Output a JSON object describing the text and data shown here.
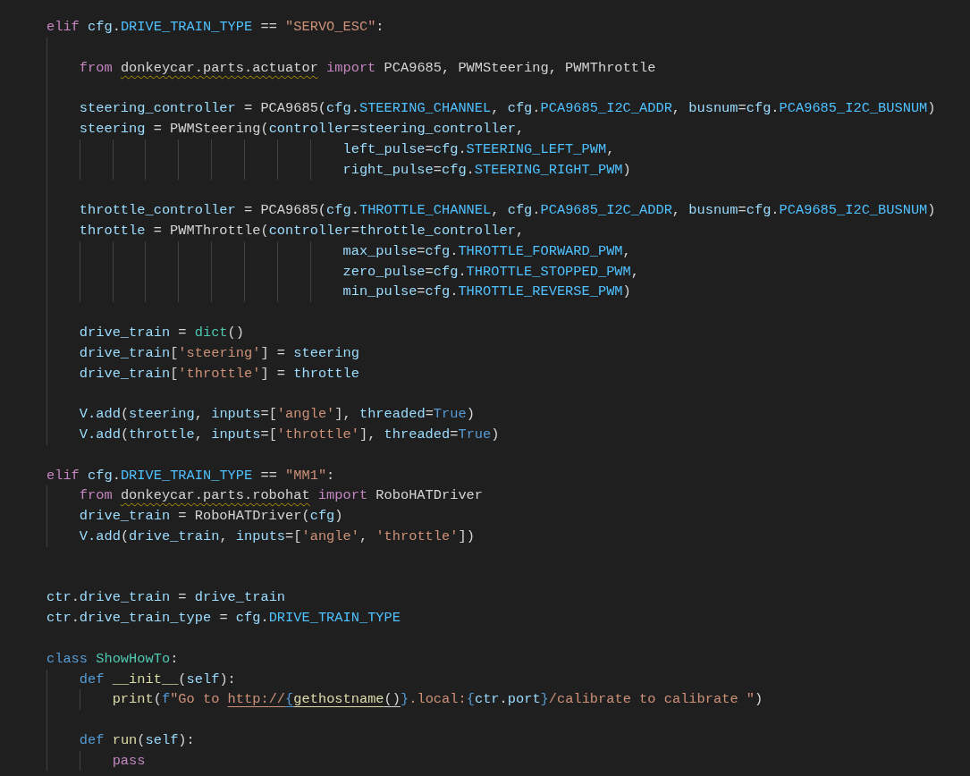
{
  "editor": {
    "lines": [
      {
        "kind": "code",
        "tokens": [
          {
            "t": "elif ",
            "kind": "keyword"
          },
          {
            "t": "cfg",
            "kind": "variable"
          },
          {
            "t": ".",
            "kind": "plain"
          },
          {
            "t": "DRIVE_TRAIN_TYPE",
            "kind": "constant"
          },
          {
            "t": " == ",
            "kind": "plain"
          },
          {
            "t": "\"SERVO_ESC\"",
            "kind": "string"
          },
          {
            "t": ":",
            "kind": "plain"
          }
        ]
      },
      {
        "kind": "blank"
      },
      {
        "kind": "code",
        "tokens": [
          {
            "t": "    from ",
            "kind": "keyword"
          },
          {
            "t": "donkeycar.parts.actuator",
            "kind": "unresolved"
          },
          {
            "t": " import ",
            "kind": "keyword"
          },
          {
            "t": "PCA9685, PWMSteering, PWMThrottle",
            "kind": "plain"
          }
        ]
      },
      {
        "kind": "blank"
      },
      {
        "kind": "code",
        "tokens": [
          {
            "t": "    steering_controller",
            "kind": "variable"
          },
          {
            "t": " = PCA9685(",
            "kind": "plain"
          },
          {
            "t": "cfg",
            "kind": "variable"
          },
          {
            "t": ".",
            "kind": "plain"
          },
          {
            "t": "STEERING_CHANNEL",
            "kind": "constant"
          },
          {
            "t": ", ",
            "kind": "plain"
          },
          {
            "t": "cfg",
            "kind": "variable"
          },
          {
            "t": ".",
            "kind": "plain"
          },
          {
            "t": "PCA9685_I2C_ADDR",
            "kind": "constant"
          },
          {
            "t": ", ",
            "kind": "plain"
          },
          {
            "t": "busnum",
            "kind": "variable"
          },
          {
            "t": "=",
            "kind": "plain"
          },
          {
            "t": "cfg",
            "kind": "variable"
          },
          {
            "t": ".",
            "kind": "plain"
          },
          {
            "t": "PCA9685_I2C_BUSNUM",
            "kind": "constant"
          },
          {
            "t": ")",
            "kind": "plain"
          }
        ]
      },
      {
        "kind": "code",
        "tokens": [
          {
            "t": "    steering",
            "kind": "variable"
          },
          {
            "t": " = PWMSteering(",
            "kind": "plain"
          },
          {
            "t": "controller",
            "kind": "variable"
          },
          {
            "t": "=",
            "kind": "plain"
          },
          {
            "t": "steering_controller",
            "kind": "variable"
          },
          {
            "t": ",",
            "kind": "plain"
          }
        ]
      },
      {
        "kind": "code",
        "tokens": [
          {
            "t": "                                    left_pulse",
            "kind": "variable"
          },
          {
            "t": "=",
            "kind": "plain"
          },
          {
            "t": "cfg",
            "kind": "variable"
          },
          {
            "t": ".",
            "kind": "plain"
          },
          {
            "t": "STEERING_LEFT_PWM",
            "kind": "constant"
          },
          {
            "t": ",",
            "kind": "plain"
          }
        ]
      },
      {
        "kind": "code",
        "tokens": [
          {
            "t": "                                    right_pulse",
            "kind": "variable"
          },
          {
            "t": "=",
            "kind": "plain"
          },
          {
            "t": "cfg",
            "kind": "variable"
          },
          {
            "t": ".",
            "kind": "plain"
          },
          {
            "t": "STEERING_RIGHT_PWM",
            "kind": "constant"
          },
          {
            "t": ")",
            "kind": "plain"
          }
        ]
      },
      {
        "kind": "blank"
      },
      {
        "kind": "code",
        "tokens": [
          {
            "t": "    throttle_controller",
            "kind": "variable"
          },
          {
            "t": " = PCA9685(",
            "kind": "plain"
          },
          {
            "t": "cfg",
            "kind": "variable"
          },
          {
            "t": ".",
            "kind": "plain"
          },
          {
            "t": "THROTTLE_CHANNEL",
            "kind": "constant"
          },
          {
            "t": ", ",
            "kind": "plain"
          },
          {
            "t": "cfg",
            "kind": "variable"
          },
          {
            "t": ".",
            "kind": "plain"
          },
          {
            "t": "PCA9685_I2C_ADDR",
            "kind": "constant"
          },
          {
            "t": ", ",
            "kind": "plain"
          },
          {
            "t": "busnum",
            "kind": "variable"
          },
          {
            "t": "=",
            "kind": "plain"
          },
          {
            "t": "cfg",
            "kind": "variable"
          },
          {
            "t": ".",
            "kind": "plain"
          },
          {
            "t": "PCA9685_I2C_BUSNUM",
            "kind": "constant"
          },
          {
            "t": ")",
            "kind": "plain"
          }
        ]
      },
      {
        "kind": "code",
        "tokens": [
          {
            "t": "    throttle",
            "kind": "variable"
          },
          {
            "t": " = PWMThrottle(",
            "kind": "plain"
          },
          {
            "t": "controller",
            "kind": "variable"
          },
          {
            "t": "=",
            "kind": "plain"
          },
          {
            "t": "throttle_controller",
            "kind": "variable"
          },
          {
            "t": ",",
            "kind": "plain"
          }
        ]
      },
      {
        "kind": "code",
        "tokens": [
          {
            "t": "                                    max_pulse",
            "kind": "variable"
          },
          {
            "t": "=",
            "kind": "plain"
          },
          {
            "t": "cfg",
            "kind": "variable"
          },
          {
            "t": ".",
            "kind": "plain"
          },
          {
            "t": "THROTTLE_FORWARD_PWM",
            "kind": "constant"
          },
          {
            "t": ",",
            "kind": "plain"
          }
        ]
      },
      {
        "kind": "code",
        "tokens": [
          {
            "t": "                                    zero_pulse",
            "kind": "variable"
          },
          {
            "t": "=",
            "kind": "plain"
          },
          {
            "t": "cfg",
            "kind": "variable"
          },
          {
            "t": ".",
            "kind": "plain"
          },
          {
            "t": "THROTTLE_STOPPED_PWM",
            "kind": "constant"
          },
          {
            "t": ",",
            "kind": "plain"
          }
        ]
      },
      {
        "kind": "code",
        "tokens": [
          {
            "t": "                                    min_pulse",
            "kind": "variable"
          },
          {
            "t": "=",
            "kind": "plain"
          },
          {
            "t": "cfg",
            "kind": "variable"
          },
          {
            "t": ".",
            "kind": "plain"
          },
          {
            "t": "THROTTLE_REVERSE_PWM",
            "kind": "constant"
          },
          {
            "t": ")",
            "kind": "plain"
          }
        ]
      },
      {
        "kind": "blank"
      },
      {
        "kind": "code",
        "tokens": [
          {
            "t": "    drive_train",
            "kind": "variable"
          },
          {
            "t": " = ",
            "kind": "plain"
          },
          {
            "t": "dict",
            "kind": "class"
          },
          {
            "t": "()",
            "kind": "plain"
          }
        ]
      },
      {
        "kind": "code",
        "tokens": [
          {
            "t": "    drive_train",
            "kind": "variable"
          },
          {
            "t": "[",
            "kind": "plain"
          },
          {
            "t": "'steering'",
            "kind": "string"
          },
          {
            "t": "] = ",
            "kind": "plain"
          },
          {
            "t": "steering",
            "kind": "variable"
          }
        ]
      },
      {
        "kind": "code",
        "tokens": [
          {
            "t": "    drive_train",
            "kind": "variable"
          },
          {
            "t": "[",
            "kind": "plain"
          },
          {
            "t": "'throttle'",
            "kind": "string"
          },
          {
            "t": "] = ",
            "kind": "plain"
          },
          {
            "t": "throttle",
            "kind": "variable"
          }
        ]
      },
      {
        "kind": "blank"
      },
      {
        "kind": "code",
        "tokens": [
          {
            "t": "    V.add",
            "kind": "variable"
          },
          {
            "t": "(",
            "kind": "plain"
          },
          {
            "t": "steering",
            "kind": "variable"
          },
          {
            "t": ", ",
            "kind": "plain"
          },
          {
            "t": "inputs",
            "kind": "variable"
          },
          {
            "t": "=[",
            "kind": "plain"
          },
          {
            "t": "'angle'",
            "kind": "string"
          },
          {
            "t": "], ",
            "kind": "plain"
          },
          {
            "t": "threaded",
            "kind": "variable"
          },
          {
            "t": "=",
            "kind": "plain"
          },
          {
            "t": "True",
            "kind": "storage"
          },
          {
            "t": ")",
            "kind": "plain"
          }
        ]
      },
      {
        "kind": "code",
        "tokens": [
          {
            "t": "    V.add",
            "kind": "variable"
          },
          {
            "t": "(",
            "kind": "plain"
          },
          {
            "t": "throttle",
            "kind": "variable"
          },
          {
            "t": ", ",
            "kind": "plain"
          },
          {
            "t": "inputs",
            "kind": "variable"
          },
          {
            "t": "=[",
            "kind": "plain"
          },
          {
            "t": "'throttle'",
            "kind": "string"
          },
          {
            "t": "], ",
            "kind": "plain"
          },
          {
            "t": "threaded",
            "kind": "variable"
          },
          {
            "t": "=",
            "kind": "plain"
          },
          {
            "t": "True",
            "kind": "storage"
          },
          {
            "t": ")",
            "kind": "plain"
          }
        ]
      },
      {
        "kind": "blank"
      },
      {
        "kind": "code",
        "tokens": [
          {
            "t": "elif ",
            "kind": "keyword"
          },
          {
            "t": "cfg",
            "kind": "variable"
          },
          {
            "t": ".",
            "kind": "plain"
          },
          {
            "t": "DRIVE_TRAIN_TYPE",
            "kind": "constant"
          },
          {
            "t": " == ",
            "kind": "plain"
          },
          {
            "t": "\"MM1\"",
            "kind": "string"
          },
          {
            "t": ":",
            "kind": "plain"
          }
        ]
      },
      {
        "kind": "code",
        "tokens": [
          {
            "t": "    from ",
            "kind": "keyword"
          },
          {
            "t": "donkeycar.parts.robohat",
            "kind": "unresolved"
          },
          {
            "t": " import ",
            "kind": "keyword"
          },
          {
            "t": "RoboHATDriver",
            "kind": "plain"
          }
        ]
      },
      {
        "kind": "code",
        "tokens": [
          {
            "t": "    drive_train",
            "kind": "variable"
          },
          {
            "t": " = RoboHATDriver(",
            "kind": "plain"
          },
          {
            "t": "cfg",
            "kind": "variable"
          },
          {
            "t": ")",
            "kind": "plain"
          }
        ]
      },
      {
        "kind": "code",
        "tokens": [
          {
            "t": "    V.add",
            "kind": "variable"
          },
          {
            "t": "(",
            "kind": "plain"
          },
          {
            "t": "drive_train",
            "kind": "variable"
          },
          {
            "t": ", ",
            "kind": "plain"
          },
          {
            "t": "inputs",
            "kind": "variable"
          },
          {
            "t": "=[",
            "kind": "plain"
          },
          {
            "t": "'angle'",
            "kind": "string"
          },
          {
            "t": ", ",
            "kind": "plain"
          },
          {
            "t": "'throttle'",
            "kind": "string"
          },
          {
            "t": "])",
            "kind": "plain"
          }
        ]
      },
      {
        "kind": "blank"
      },
      {
        "kind": "blank"
      },
      {
        "kind": "code",
        "tokens": [
          {
            "t": "ctr",
            "kind": "variable"
          },
          {
            "t": ".",
            "kind": "plain"
          },
          {
            "t": "drive_train",
            "kind": "variable"
          },
          {
            "t": " = ",
            "kind": "plain"
          },
          {
            "t": "drive_train",
            "kind": "variable"
          }
        ]
      },
      {
        "kind": "code",
        "tokens": [
          {
            "t": "ctr",
            "kind": "variable"
          },
          {
            "t": ".",
            "kind": "plain"
          },
          {
            "t": "drive_train_type",
            "kind": "variable"
          },
          {
            "t": " = ",
            "kind": "plain"
          },
          {
            "t": "cfg",
            "kind": "variable"
          },
          {
            "t": ".",
            "kind": "plain"
          },
          {
            "t": "DRIVE_TRAIN_TYPE",
            "kind": "constant"
          }
        ]
      },
      {
        "kind": "blank"
      },
      {
        "kind": "code",
        "tokens": [
          {
            "t": "class ",
            "kind": "storage"
          },
          {
            "t": "ShowHowTo",
            "kind": "class"
          },
          {
            "t": ":",
            "kind": "plain"
          }
        ]
      },
      {
        "kind": "code",
        "tokens": [
          {
            "t": "    def ",
            "kind": "storage"
          },
          {
            "t": "__init__",
            "kind": "function"
          },
          {
            "t": "(",
            "kind": "plain"
          },
          {
            "t": "self",
            "kind": "variable"
          },
          {
            "t": "):",
            "kind": "plain"
          }
        ]
      },
      {
        "kind": "code",
        "tokens": [
          {
            "t": "        print",
            "kind": "function"
          },
          {
            "t": "(",
            "kind": "plain"
          },
          {
            "t": "f",
            "kind": "storage"
          },
          {
            "t": "\"Go to ",
            "kind": "string"
          },
          {
            "t": "http://",
            "kind": "link_string"
          },
          {
            "t": "{",
            "kind": "link_storage"
          },
          {
            "t": "gethostname",
            "kind": "link_function"
          },
          {
            "t": "()",
            "kind": "link_plain"
          },
          {
            "t": "}",
            "kind": "storage"
          },
          {
            "t": ".local:",
            "kind": "string"
          },
          {
            "t": "{",
            "kind": "storage"
          },
          {
            "t": "ctr",
            "kind": "variable"
          },
          {
            "t": ".",
            "kind": "plain"
          },
          {
            "t": "port",
            "kind": "variable"
          },
          {
            "t": "}",
            "kind": "storage"
          },
          {
            "t": "/calibrate to calibrate \"",
            "kind": "string"
          },
          {
            "t": ")",
            "kind": "plain"
          }
        ]
      },
      {
        "kind": "blank"
      },
      {
        "kind": "code",
        "tokens": [
          {
            "t": "    def ",
            "kind": "storage"
          },
          {
            "t": "run",
            "kind": "function"
          },
          {
            "t": "(",
            "kind": "plain"
          },
          {
            "t": "self",
            "kind": "variable"
          },
          {
            "t": "):",
            "kind": "plain"
          }
        ]
      },
      {
        "kind": "code",
        "tokens": [
          {
            "t": "        pass",
            "kind": "keyword"
          }
        ]
      }
    ]
  }
}
